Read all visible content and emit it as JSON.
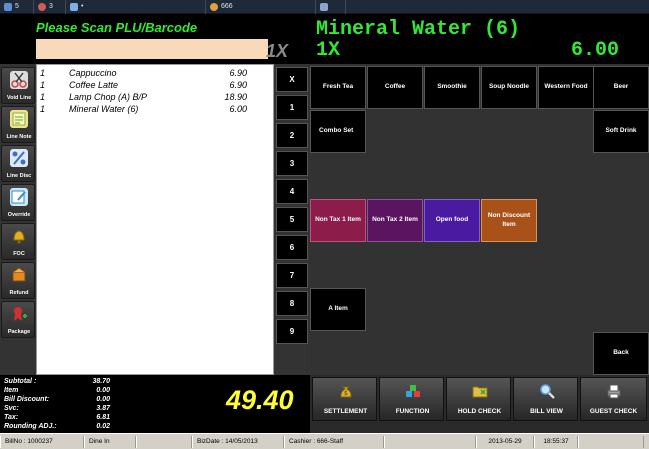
{
  "topbar": {
    "items": [
      {
        "icon": "monitor-icon",
        "label": "5"
      },
      {
        "icon": "people-icon",
        "label": "3"
      },
      {
        "icon": "window-icon",
        "label": "•"
      },
      {
        "icon": "user-icon",
        "label": "666"
      },
      {
        "icon": "network-icon",
        "label": ""
      }
    ]
  },
  "scan": {
    "prompt": "Please Scan PLU/Barcode",
    "input_value": "",
    "multiplier": "1X"
  },
  "display": {
    "item_name": "Mineral Water (6)",
    "qty": "1X",
    "amount": "6.00",
    "color": "#33e833"
  },
  "tools": [
    {
      "label": "Void Line",
      "icon": "scissors-icon",
      "color": "#c84b4b"
    },
    {
      "label": "Line Note",
      "icon": "note-icon",
      "color": "#7ab648"
    },
    {
      "label": "Line Disc",
      "icon": "percent-icon",
      "color": "#3c6fc4"
    },
    {
      "label": "Override",
      "icon": "edit-icon",
      "color": "#2f8fd0"
    },
    {
      "label": "FOC",
      "icon": "bell-icon",
      "color": "#e0b020"
    },
    {
      "label": "Refund",
      "icon": "box-icon",
      "color": "#e08a20"
    },
    {
      "label": "Package",
      "icon": "ribbon-icon",
      "color": "#d03030"
    }
  ],
  "order": {
    "lines": [
      {
        "qty": "1",
        "name": "Cappuccino",
        "price": "6.90"
      },
      {
        "qty": "1",
        "name": "Coffee Latte",
        "price": "6.90"
      },
      {
        "qty": "1",
        "name": "Lamp Chop (A) B/P",
        "price": "18.90"
      },
      {
        "qty": "1",
        "name": "Mineral Water (6)",
        "price": "6.00"
      }
    ]
  },
  "numpad": [
    "X",
    "1",
    "2",
    "3",
    "4",
    "5",
    "6",
    "7",
    "8",
    "9"
  ],
  "grid": {
    "row1": [
      "Fresh Tea",
      "Coffee",
      "Smoothie",
      "Soup Noodle",
      "Western Food",
      "Beer"
    ],
    "combo": "Combo Set",
    "soft_drink": "Soft Drink",
    "specials": [
      {
        "label": "Non Tax 1 Item",
        "color": "#8c1c4a"
      },
      {
        "label": "Non Tax 2 Item",
        "color": "#5a1460"
      },
      {
        "label": "Open food",
        "color": "#4a1aa0"
      },
      {
        "label": "Non Discount Item",
        "color": "#a8521a"
      }
    ],
    "a_item": "A Item",
    "back": "Back"
  },
  "totals": {
    "rows": [
      {
        "label": "Subtotal :",
        "value": "38.70"
      },
      {
        "label": "Item",
        "value": "0.00"
      },
      {
        "label": "Bill Discount:",
        "value": "0.00"
      },
      {
        "label": "Svc:",
        "value": "3.87"
      },
      {
        "label": "Tax:",
        "value": "6.81"
      },
      {
        "label": "Rounding ADJ.:",
        "value": "0.02"
      }
    ],
    "grand_total": "49.40",
    "grand_color": "#ffff33"
  },
  "actions": [
    {
      "label": "SETTLEMENT",
      "icon": "money-bag-icon",
      "color": "#d8b030"
    },
    {
      "label": "FUNCTION",
      "icon": "blocks-icon",
      "color": "#3aa0e0"
    },
    {
      "label": "HOLD CHECK",
      "icon": "folder-icon",
      "color": "#e0c040"
    },
    {
      "label": "BILL VIEW",
      "icon": "magnifier-icon",
      "color": "#60a0e0"
    },
    {
      "label": "GUEST CHECK",
      "icon": "printer-icon",
      "color": "#a0a0a0"
    }
  ],
  "status": {
    "bill_no": "BillNo : 1000237",
    "mode": "Dine In",
    "blank": "",
    "biz_date": "BizDate : 14/05/2013",
    "cashier": "Cashier : 666-Staff",
    "blank2": "",
    "date": "2013-05-29",
    "time": "18:55:37"
  }
}
